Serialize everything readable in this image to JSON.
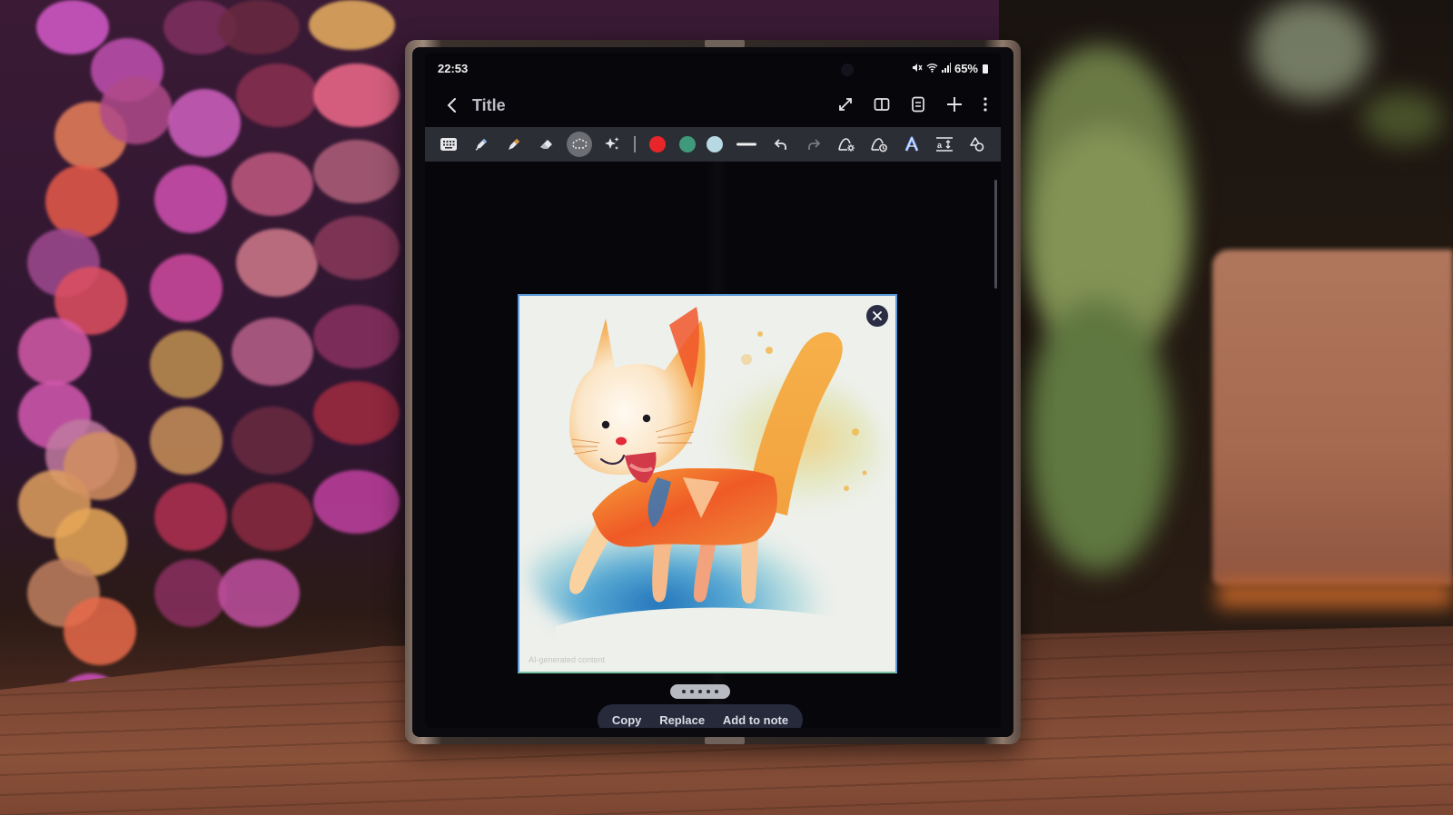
{
  "status_bar": {
    "time": "22:53",
    "battery_percent": "65%",
    "icons": [
      "mute-icon",
      "wifi-icon",
      "signal-icon",
      "battery-icon"
    ]
  },
  "app_bar": {
    "back_icon": "chevron-left-icon",
    "title": "Title",
    "actions": [
      {
        "name": "expand-button",
        "icon": "expand-icon"
      },
      {
        "name": "book-view-button",
        "icon": "book-icon"
      },
      {
        "name": "page-list-button",
        "icon": "page-list-icon"
      },
      {
        "name": "add-page-button",
        "icon": "plus-icon"
      },
      {
        "name": "more-options-button",
        "icon": "more-vertical-icon"
      }
    ]
  },
  "toolbar": {
    "tools": [
      {
        "name": "keyboard-tool",
        "icon": "keyboard-icon"
      },
      {
        "name": "pen-tool",
        "icon": "pen-icon"
      },
      {
        "name": "highlighter-tool",
        "icon": "highlighter-icon"
      },
      {
        "name": "eraser-tool",
        "icon": "eraser-icon"
      },
      {
        "name": "lasso-select-tool",
        "icon": "lasso-icon",
        "selected": true
      },
      {
        "name": "ai-assist-tool",
        "icon": "sparkles-icon"
      }
    ],
    "colors": [
      {
        "name": "red",
        "hex": "#e8262a"
      },
      {
        "name": "green",
        "hex": "#3f9a7b"
      },
      {
        "name": "light-blue",
        "hex": "#b7d9e4"
      }
    ],
    "actions": [
      {
        "name": "stroke-width",
        "icon": "line-width-icon"
      },
      {
        "name": "undo",
        "icon": "undo-icon"
      },
      {
        "name": "redo",
        "icon": "redo-icon"
      },
      {
        "name": "sketch-to-image",
        "icon": "drawing-assist-icon"
      },
      {
        "name": "drawing-style",
        "icon": "drawing-style-icon"
      },
      {
        "name": "text-style",
        "icon": "text-format-icon"
      },
      {
        "name": "text-spacing",
        "icon": "text-spacing-icon"
      },
      {
        "name": "shapes",
        "icon": "shapes-icon"
      }
    ]
  },
  "generated_image": {
    "description": "Watercolor illustration of a smiling orange cat",
    "watermark": "AI-generated content",
    "close_icon": "close-icon"
  },
  "pager": {
    "dots": 5
  },
  "popup_actions": {
    "copy": "Copy",
    "replace": "Replace",
    "add_to_note": "Add to note"
  }
}
